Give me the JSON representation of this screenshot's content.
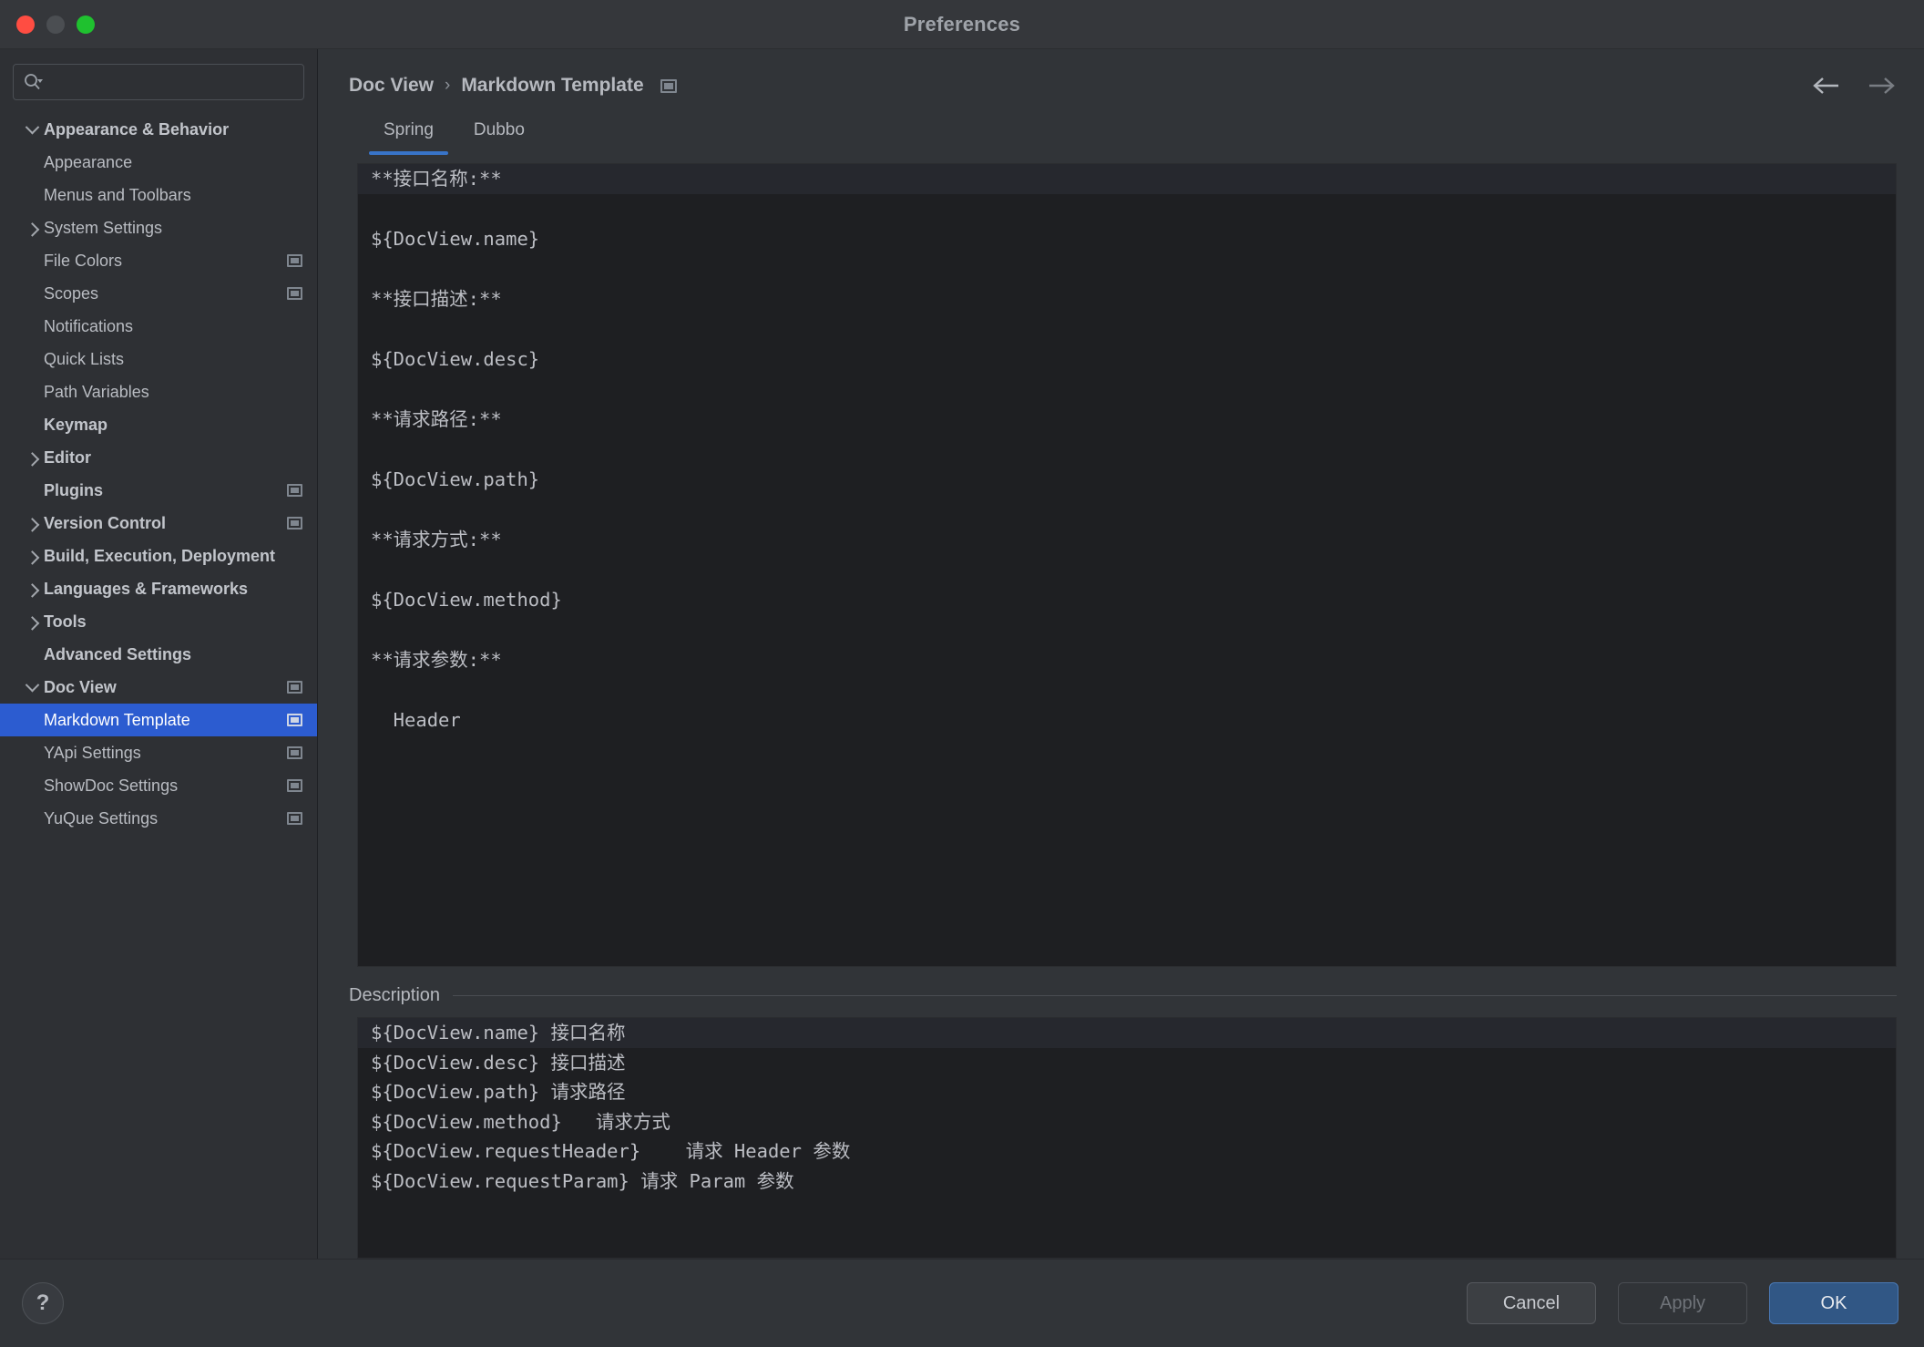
{
  "window": {
    "title": "Preferences",
    "controls": [
      "close-button",
      "minimize-button",
      "zoom-button"
    ]
  },
  "sidebar": {
    "search": {
      "value": "",
      "placeholder": ""
    },
    "items": [
      {
        "label": "Appearance & Behavior",
        "indent": 0,
        "bold": true,
        "arrow": "down",
        "badge": false,
        "selected": false
      },
      {
        "label": "Appearance",
        "indent": 1,
        "bold": false,
        "arrow": "none",
        "badge": false,
        "selected": false
      },
      {
        "label": "Menus and Toolbars",
        "indent": 1,
        "bold": false,
        "arrow": "none",
        "badge": false,
        "selected": false
      },
      {
        "label": "System Settings",
        "indent": 1,
        "bold": false,
        "arrow": "right",
        "badge": false,
        "selected": false
      },
      {
        "label": "File Colors",
        "indent": 1,
        "bold": false,
        "arrow": "none",
        "badge": true,
        "selected": false
      },
      {
        "label": "Scopes",
        "indent": 1,
        "bold": false,
        "arrow": "none",
        "badge": true,
        "selected": false
      },
      {
        "label": "Notifications",
        "indent": 1,
        "bold": false,
        "arrow": "none",
        "badge": false,
        "selected": false
      },
      {
        "label": "Quick Lists",
        "indent": 1,
        "bold": false,
        "arrow": "none",
        "badge": false,
        "selected": false
      },
      {
        "label": "Path Variables",
        "indent": 1,
        "bold": false,
        "arrow": "none",
        "badge": false,
        "selected": false
      },
      {
        "label": "Keymap",
        "indent": 0,
        "bold": true,
        "arrow": "none",
        "badge": false,
        "selected": false
      },
      {
        "label": "Editor",
        "indent": 0,
        "bold": true,
        "arrow": "right",
        "badge": false,
        "selected": false
      },
      {
        "label": "Plugins",
        "indent": 0,
        "bold": true,
        "arrow": "none",
        "badge": true,
        "selected": false
      },
      {
        "label": "Version Control",
        "indent": 0,
        "bold": true,
        "arrow": "right",
        "badge": true,
        "selected": false
      },
      {
        "label": "Build, Execution, Deployment",
        "indent": 0,
        "bold": true,
        "arrow": "right",
        "badge": false,
        "selected": false
      },
      {
        "label": "Languages & Frameworks",
        "indent": 0,
        "bold": true,
        "arrow": "right",
        "badge": false,
        "selected": false
      },
      {
        "label": "Tools",
        "indent": 0,
        "bold": true,
        "arrow": "right",
        "badge": false,
        "selected": false
      },
      {
        "label": "Advanced Settings",
        "indent": 0,
        "bold": true,
        "arrow": "none",
        "badge": false,
        "selected": false
      },
      {
        "label": "Doc View",
        "indent": 0,
        "bold": true,
        "arrow": "down",
        "badge": true,
        "selected": false
      },
      {
        "label": "Markdown Template",
        "indent": 1,
        "bold": false,
        "arrow": "none",
        "badge": true,
        "selected": true
      },
      {
        "label": "YApi Settings",
        "indent": 1,
        "bold": false,
        "arrow": "none",
        "badge": true,
        "selected": false
      },
      {
        "label": "ShowDoc Settings",
        "indent": 1,
        "bold": false,
        "arrow": "none",
        "badge": true,
        "selected": false
      },
      {
        "label": "YuQue Settings",
        "indent": 1,
        "bold": false,
        "arrow": "none",
        "badge": true,
        "selected": false
      }
    ]
  },
  "main": {
    "breadcrumb": {
      "parent": "Doc View",
      "separator": "›",
      "current": "Markdown Template"
    },
    "nav": {
      "back": "back-arrow",
      "forward": "forward-arrow"
    },
    "tabs": [
      {
        "label": "Spring",
        "active": true
      },
      {
        "label": "Dubbo",
        "active": false
      }
    ],
    "editor": {
      "lines": [
        "**接口名称:**",
        "",
        "${DocView.name}",
        "",
        "**接口描述:**",
        "",
        "${DocView.desc}",
        "",
        "**请求路径:**",
        "",
        "${DocView.path}",
        "",
        "**请求方式:**",
        "",
        "${DocView.method}",
        "",
        "**请求参数:**",
        "",
        "  Header"
      ],
      "highlighted_line_index": 0
    },
    "description": {
      "label": "Description",
      "lines": [
        "${DocView.name} 接口名称",
        "${DocView.desc} 接口描述",
        "${DocView.path} 请求路径",
        "${DocView.method}   请求方式",
        "${DocView.requestHeader}    请求 Header 参数",
        "${DocView.requestParam} 请求 Param 参数"
      ],
      "highlighted_line_index": 0
    }
  },
  "footer": {
    "help_label": "?",
    "buttons": [
      {
        "label": "Cancel",
        "style": "secondary"
      },
      {
        "label": "Apply",
        "style": "disabled"
      },
      {
        "label": "OK",
        "style": "primary"
      }
    ]
  },
  "colors": {
    "accent": "#2c5cd0",
    "tab_underline": "#3874c8",
    "primary_button": "#315785",
    "editor_background": "#1e1f22",
    "window_background": "#313438"
  }
}
